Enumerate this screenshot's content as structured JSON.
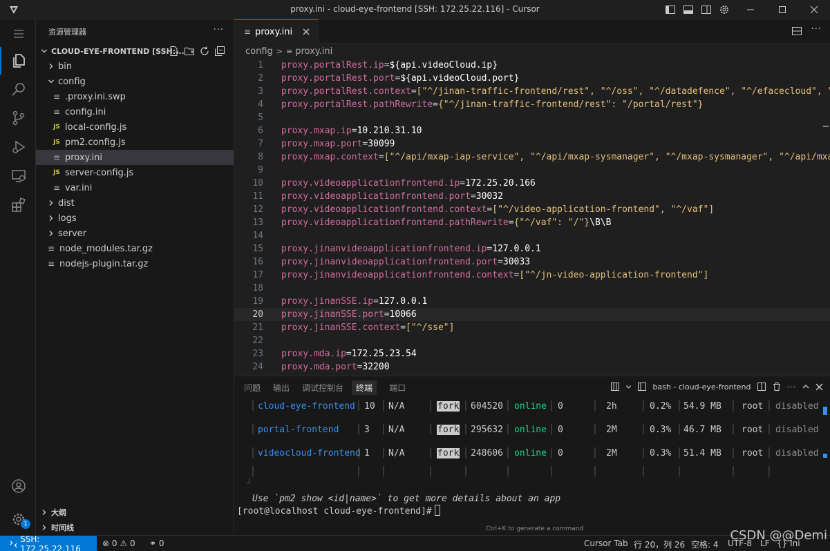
{
  "window": {
    "title": "proxy.ini - cloud-eye-frontend [SSH: 172.25.22.116] - Cursor"
  },
  "sidebar": {
    "title": "资源管理器",
    "more": "···",
    "root": "CLOUD-EYE-FRONTEND [SSH:...",
    "tree": [
      {
        "label": "bin",
        "type": "folder",
        "expanded": false,
        "depth": 0
      },
      {
        "label": "config",
        "type": "folder",
        "expanded": true,
        "depth": 0
      },
      {
        "label": ".proxy.ini.swp",
        "type": "file",
        "icon": "lines",
        "depth": 1
      },
      {
        "label": "config.ini",
        "type": "file",
        "icon": "lines",
        "depth": 1
      },
      {
        "label": "local-config.js",
        "type": "file",
        "icon": "js",
        "depth": 1
      },
      {
        "label": "pm2.config.js",
        "type": "file",
        "icon": "js",
        "depth": 1
      },
      {
        "label": "proxy.ini",
        "type": "file",
        "icon": "lines",
        "depth": 1,
        "selected": true
      },
      {
        "label": "server-config.js",
        "type": "file",
        "icon": "js",
        "depth": 1
      },
      {
        "label": "var.ini",
        "type": "file",
        "icon": "lines",
        "depth": 1
      },
      {
        "label": "dist",
        "type": "folder",
        "expanded": false,
        "depth": 0
      },
      {
        "label": "logs",
        "type": "folder",
        "expanded": false,
        "depth": 0
      },
      {
        "label": "server",
        "type": "folder",
        "expanded": false,
        "depth": 0
      },
      {
        "label": "node_modules.tar.gz",
        "type": "file",
        "icon": "lines",
        "depth": 0
      },
      {
        "label": "nodejs-plugin.tar.gz",
        "type": "file",
        "icon": "lines",
        "depth": 0
      }
    ],
    "outline": "大纲",
    "timeline": "时间线"
  },
  "activity": {
    "account_badge": "1"
  },
  "editor": {
    "tab_label": "proxy.ini",
    "tab_more": "···",
    "breadcrumb": [
      "config",
      "proxy.ini"
    ],
    "current_line": 20,
    "lines": [
      {
        "n": "1",
        "key": "proxy.portalRest.ip",
        "val": "${api.videoCloud.ip}",
        "vtype": "v"
      },
      {
        "n": "2",
        "key": "proxy.portalRest.port",
        "val": "${api.videoCloud.port}",
        "vtype": "v"
      },
      {
        "n": "3",
        "key": "proxy.portalRest.context",
        "val": "[\"^/jinan-traffic-frontend/rest\", \"^/oss\", \"^/datadefence\", \"^/efacecloud\", \"^",
        "vtype": "s"
      },
      {
        "n": "4",
        "key": "proxy.portalRest.pathRewrite",
        "val": "{\"^/jinan-traffic-frontend/rest\": \"/portal/rest\"}",
        "vtype": "s"
      },
      {
        "n": "5",
        "key": "",
        "val": "",
        "vtype": "v"
      },
      {
        "n": "6",
        "key": "proxy.mxap.ip",
        "val": "10.210.31.10",
        "vtype": "v"
      },
      {
        "n": "7",
        "key": "proxy.mxap.port",
        "val": "30099",
        "vtype": "v"
      },
      {
        "n": "8",
        "key": "proxy.mxap.context",
        "val": "[\"^/api/mxap-iap-service\", \"^/api/mxap-sysmanager\", \"^/mxap-sysmanager\", \"^/api/mxap",
        "vtype": "s"
      },
      {
        "n": "9",
        "key": "",
        "val": "",
        "vtype": "v"
      },
      {
        "n": "10",
        "key": "proxy.videoapplicationfrontend.ip",
        "val": "172.25.20.166",
        "vtype": "v"
      },
      {
        "n": "11",
        "key": "proxy.videoapplicationfrontend.port",
        "val": "30032",
        "vtype": "v"
      },
      {
        "n": "12",
        "key": "proxy.videoapplicationfrontend.context",
        "val": "[\"^/video-application-frontend\", \"^/vaf\"]",
        "vtype": "s"
      },
      {
        "n": "13",
        "key": "proxy.videoapplicationfrontend.pathRewrite",
        "val": "{\"^/vaf\": \"/\"}",
        "tail": "\\B\\B",
        "vtype": "s"
      },
      {
        "n": "14",
        "key": "",
        "val": "",
        "vtype": "v"
      },
      {
        "n": "15",
        "key": "proxy.jinanvideoapplicationfrontend.ip",
        "val": "127.0.0.1",
        "vtype": "v"
      },
      {
        "n": "16",
        "key": "proxy.jinanvideoapplicationfrontend.port",
        "val": "30033",
        "vtype": "v"
      },
      {
        "n": "17",
        "key": "proxy.jinanvideoapplicationfrontend.context",
        "val": "[\"^/jn-video-application-frontend\"]",
        "vtype": "s"
      },
      {
        "n": "18",
        "key": "",
        "val": "",
        "vtype": "v"
      },
      {
        "n": "19",
        "key": "proxy.jinanSSE.ip",
        "val": "127.0.0.1",
        "vtype": "v"
      },
      {
        "n": "20",
        "key": "proxy.jinanSSE.port",
        "val": "10066",
        "vtype": "v"
      },
      {
        "n": "21",
        "key": "proxy.jinanSSE.context",
        "val": "[\"^/sse\"]",
        "vtype": "s"
      },
      {
        "n": "22",
        "key": "",
        "val": "",
        "vtype": "v"
      },
      {
        "n": "23",
        "key": "proxy.mda.ip",
        "val": "172.25.23.54",
        "vtype": "v"
      },
      {
        "n": "24",
        "key": "proxy.mda.port",
        "val": "32200",
        "vtype": "v"
      }
    ]
  },
  "panel": {
    "tabs": [
      "问题",
      "输出",
      "调试控制台",
      "终端",
      "端口"
    ],
    "active_tab": "终端",
    "terminal_name": "bash - cloud-eye-frontend",
    "processes": [
      {
        "name": "cloud-eye-frontend",
        "id": "10",
        "version": "N/A",
        "mode": "fork",
        "pid": "604520",
        "status": "online",
        "restarts": "0",
        "uptime": "2h",
        "cpu": "0.2%",
        "mem": "54.9 MB",
        "user": "root",
        "watching": "disabled"
      },
      {
        "name": "portal-frontend",
        "id": "3",
        "version": "N/A",
        "mode": "fork",
        "pid": "295632",
        "status": "online",
        "restarts": "0",
        "uptime": "2M",
        "cpu": "0.3%",
        "mem": "46.7 MB",
        "user": "root",
        "watching": "disabled"
      },
      {
        "name": "videocloud-frontend",
        "id": "1",
        "version": "N/A",
        "mode": "fork",
        "pid": "248606",
        "status": "online",
        "restarts": "0",
        "uptime": "2M",
        "cpu": "0.3%",
        "mem": "51.4 MB",
        "user": "root",
        "watching": "disabled"
      }
    ],
    "table_end": "┘",
    "hint": "Use `pm2 show <id|name>` to get more details about an app",
    "prompt": "[root@localhost cloud-eye-frontend]#",
    "ctrl_k_hint": "Ctrl+K to generate a command"
  },
  "statusbar": {
    "remote": "SSH: 172.25.22.116",
    "errors": "0",
    "warnings": "0",
    "ports": "0",
    "cursor_tab": "Cursor Tab",
    "position": "行 20，列 26",
    "indent": "空格: 4",
    "encoding": "UTF-8",
    "eol": "LF",
    "language": "Ini"
  },
  "watermark": "CSDN @@Demi"
}
